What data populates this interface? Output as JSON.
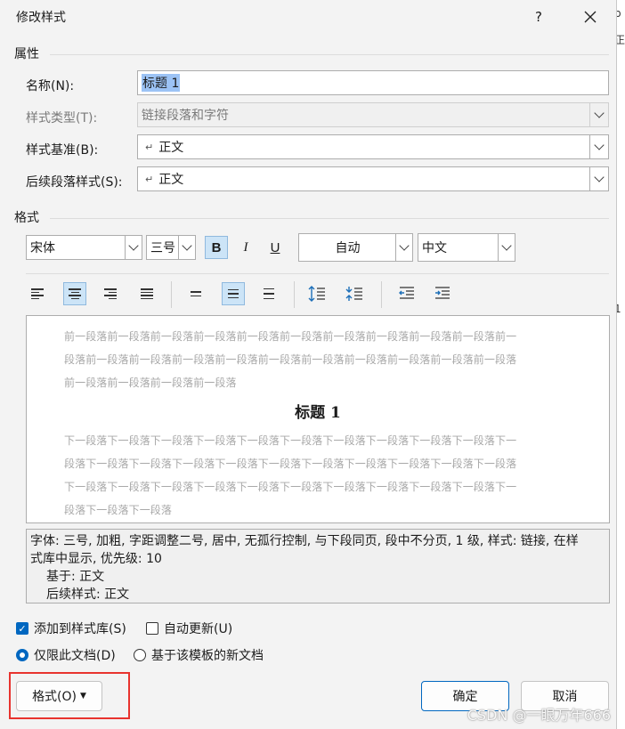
{
  "dialog": {
    "title": "修改样式",
    "help_label": "?",
    "close_label": "✕"
  },
  "props": {
    "section": "属性",
    "name_label": "名称(N):",
    "name_value": "标题 1",
    "type_label": "样式类型(T):",
    "type_value": "链接段落和字符",
    "base_label": "样式基准(B):",
    "base_value": "正文",
    "next_label": "后续段落样式(S):",
    "next_value": "正文"
  },
  "format": {
    "section": "格式",
    "font": "宋体",
    "size": "三号",
    "bold": "B",
    "italic": "I",
    "underline": "U",
    "color": "自动",
    "script": "中文"
  },
  "preview": {
    "prev_lines": [
      "前一段落前一段落前一段落前一段落前一段落前一段落前一段落前一段落前一段落前一段落前一",
      "段落前一段落前一段落前一段落前一段落前一段落前一段落前一段落前一段落前一段落前一段落",
      "前一段落前一段落前一段落前一段落"
    ],
    "heading": "标题 1",
    "next_lines": [
      "下一段落下一段落下一段落下一段落下一段落下一段落下一段落下一段落下一段落下一段落下一",
      "段落下一段落下一段落下一段落下一段落下一段落下一段落下一段落下一段落下一段落下一段落",
      "下一段落下一段落下一段落下一段落下一段落下一段落下一段落下一段落下一段落下一段落下一",
      "段落下一段落下一段落"
    ]
  },
  "description": {
    "line1": "字体: 三号, 加粗, 字距调整二号, 居中, 无孤行控制, 与下段同页, 段中不分页, 1 级, 样式: 链接, 在样",
    "line2": "式库中显示, 优先级: 10",
    "line3": "基于: 正文",
    "line4": "后续样式: 正文"
  },
  "options": {
    "add_gallery": "添加到样式库(S)",
    "auto_update": "自动更新(U)",
    "only_doc": "仅限此文档(D)",
    "template": "基于该模板的新文档"
  },
  "buttons": {
    "format": "格式(O)",
    "ok": "确定",
    "cancel": "取消"
  },
  "background": {
    "frag1": "b",
    "frag2": "正",
    "frag3": "1"
  },
  "watermark": "CSDN @一眼万年666",
  "colors": {
    "accent": "#0067c0",
    "highlight": "#e8332e"
  }
}
